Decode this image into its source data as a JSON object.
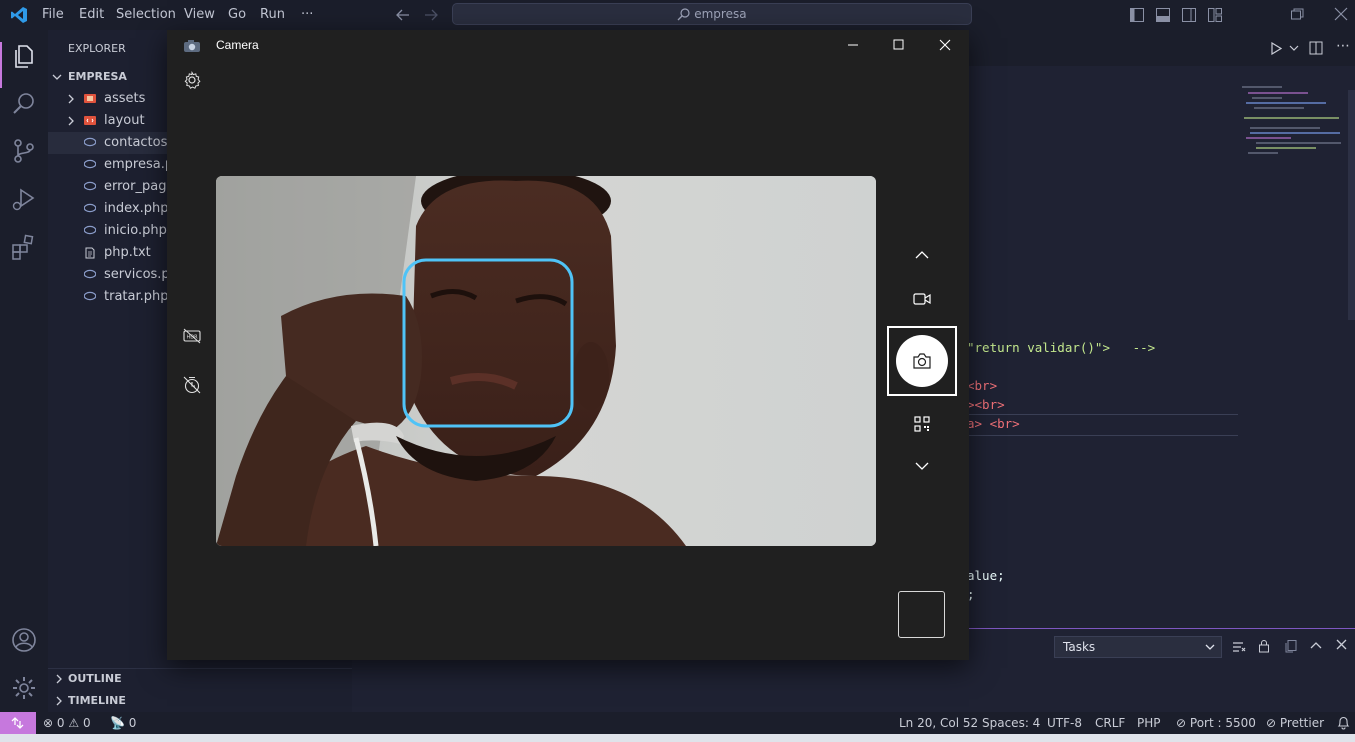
{
  "titlebar": {
    "menus": [
      "File",
      "Edit",
      "Selection",
      "View",
      "Go",
      "Run",
      "···"
    ],
    "search": "empresa"
  },
  "explorer": {
    "title": "EXPLORER",
    "folder": "EMPRESA",
    "items": [
      {
        "label": "assets",
        "kind": "folder"
      },
      {
        "label": "layout",
        "kind": "folder"
      },
      {
        "label": "contactos.php",
        "kind": "php"
      },
      {
        "label": "empresa.php",
        "kind": "php"
      },
      {
        "label": "error_page.php",
        "kind": "php"
      },
      {
        "label": "index.php",
        "kind": "php"
      },
      {
        "label": "inicio.php",
        "kind": "php"
      },
      {
        "label": "php.txt",
        "kind": "txt"
      },
      {
        "label": "servicos.php",
        "kind": "php"
      },
      {
        "label": "tratar.php",
        "kind": "php"
      }
    ],
    "outline": "OUTLINE",
    "timeline": "TIMELINE"
  },
  "editor": {
    "lines": [
      {
        "text": "\"return validar()\">   -->"
      },
      {
        "text": "<br>"
      },
      {
        "text": "><br>"
      },
      {
        "text": "a> <br>"
      },
      {
        "text": "alue;"
      },
      {
        "text": ";"
      }
    ],
    "panel_dropdown": "Tasks"
  },
  "statusbar": {
    "errors": "0",
    "warnings": "0",
    "ports": "0",
    "position": "Ln 20, Col 52",
    "spaces": "Spaces: 4",
    "encoding": "UTF-8",
    "eol": "CRLF",
    "language": "PHP",
    "port": "Port : 5500",
    "formatter": "Prettier"
  },
  "camera": {
    "title": "Camera",
    "mode_photo": "photo",
    "mode_video": "video"
  },
  "colors": {
    "accent": "#4fc3f7",
    "statusbar_remote": "#c678dd",
    "php_icon": "#8a9cc9",
    "folder_icon": "#e0533d"
  }
}
